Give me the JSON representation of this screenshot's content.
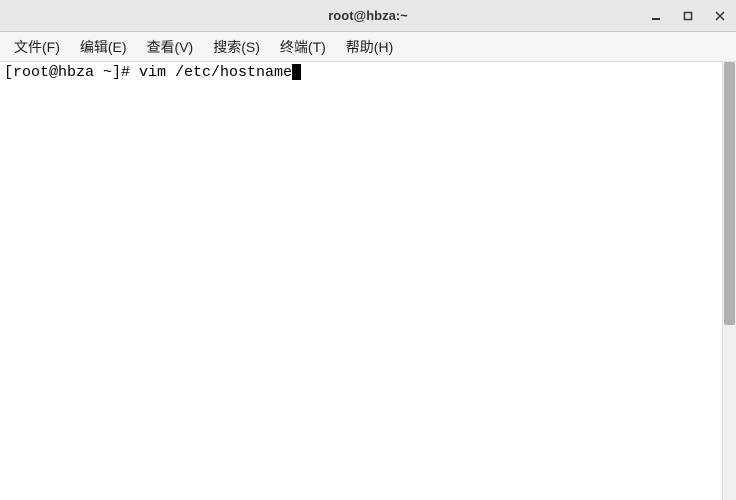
{
  "window": {
    "title": "root@hbza:~"
  },
  "menubar": {
    "items": [
      {
        "label": "文件(F)"
      },
      {
        "label": "编辑(E)"
      },
      {
        "label": "查看(V)"
      },
      {
        "label": "搜索(S)"
      },
      {
        "label": "终端(T)"
      },
      {
        "label": "帮助(H)"
      }
    ]
  },
  "terminal": {
    "prompt": "[root@hbza ~]# ",
    "command": "vim /etc/hostname"
  }
}
